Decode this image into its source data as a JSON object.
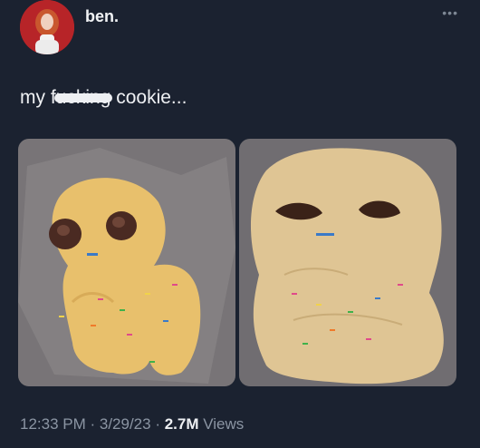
{
  "user": {
    "display_name": "ben."
  },
  "menu": {
    "more_label": "•••"
  },
  "tweet": {
    "text_before": "my f",
    "censored_word": "ucking",
    "text_after": " cookie..."
  },
  "media": [
    {
      "subject": "unbaked cookie dough figure"
    },
    {
      "subject": "baked cookie figure"
    }
  ],
  "meta": {
    "time": "12:33 PM",
    "sep1": " · ",
    "date": "3/29/23",
    "sep2": " · ",
    "views_count": "2.7M",
    "views_label": " Views"
  }
}
